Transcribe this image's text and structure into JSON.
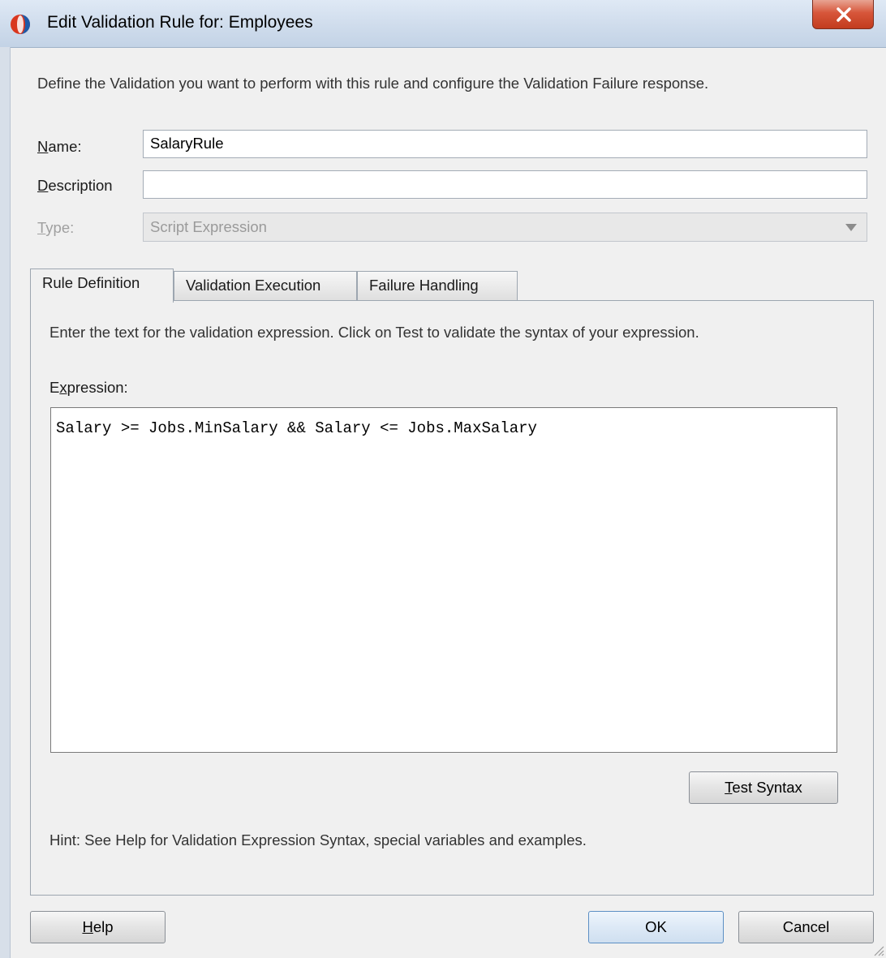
{
  "window": {
    "title": "Edit Validation Rule for: Employees",
    "close_glyph": "X"
  },
  "description": "Define the Validation you want to perform with this rule and configure the Validation Failure response.",
  "form": {
    "name_label_mnemonic": "N",
    "name_label_rest": "ame:",
    "name_value": "SalaryRule",
    "description_label_mnemonic": "D",
    "description_label_rest": "escription",
    "description_value": "",
    "type_label_mnemonic": "T",
    "type_label_rest": "ype:",
    "type_value": "Script Expression"
  },
  "tabs": [
    {
      "label": "Rule Definition",
      "active": true
    },
    {
      "label": "Validation Execution",
      "active": false
    },
    {
      "label": "Failure Handling",
      "active": false
    }
  ],
  "rule_definition": {
    "instructions": "Enter the text for the validation expression. Click on Test to validate the syntax of your expression.",
    "expression_label_pre": "E",
    "expression_label_mnemonic": "x",
    "expression_label_rest": "pression:",
    "expression_value": "Salary >= Jobs.MinSalary && Salary <= Jobs.MaxSalary",
    "test_button_mnemonic": "T",
    "test_button_rest": "est Syntax",
    "hint": "Hint: See Help for Validation Expression Syntax, special variables and examples."
  },
  "buttons": {
    "help_mnemonic": "H",
    "help_rest": "elp",
    "ok": "OK",
    "cancel": "Cancel"
  },
  "colors": {
    "close_button": "#c94a2c",
    "titlebar": "#cfdcec",
    "default_button_border": "#5c8fc4"
  },
  "icons": {
    "app": "oracle-jdeveloper-icon",
    "close": "close-icon",
    "dropdown": "chevron-down-icon",
    "resize": "resize-grip-icon"
  }
}
